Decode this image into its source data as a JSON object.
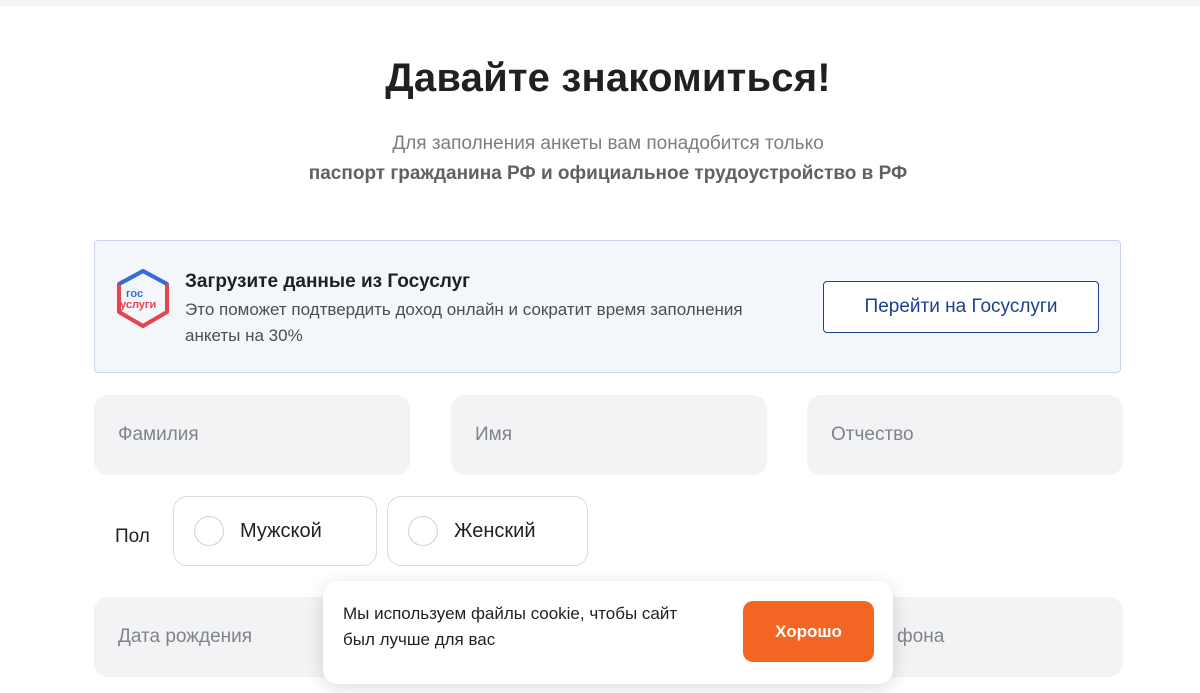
{
  "header": {
    "title": "Давайте знакомиться!",
    "subtitle_line1": "Для заполнения анкеты вам понадобится только",
    "subtitle_line2": "паспорт гражданина РФ и официальное трудоустройство в РФ"
  },
  "gosuslugi": {
    "logo_text_top": "гос",
    "logo_text_bottom": "услуги",
    "title": "Загрузите данные из Госуслуг",
    "description": "Это поможет подтвердить доход онлайн и сократит время заполнения анкеты на 30%",
    "button_label": "Перейти на Госуслуги",
    "colors": {
      "brand_blue": "#1d3f8f",
      "logo_red": "#e8424d",
      "logo_blue": "#2f6fd8"
    }
  },
  "form": {
    "surname_placeholder": "Фамилия",
    "name_placeholder": "Имя",
    "patronymic_placeholder": "Отчество",
    "gender_label": "Пол",
    "gender_options": [
      "Мужской",
      "Женский"
    ],
    "birthdate_placeholder": "Дата рождения",
    "phone_placeholder_visible": "фона"
  },
  "cookie_banner": {
    "text": "Мы используем файлы cookie, чтобы сайт был лучше для вас",
    "button_label": "Хорошо",
    "button_color": "#f26522"
  }
}
